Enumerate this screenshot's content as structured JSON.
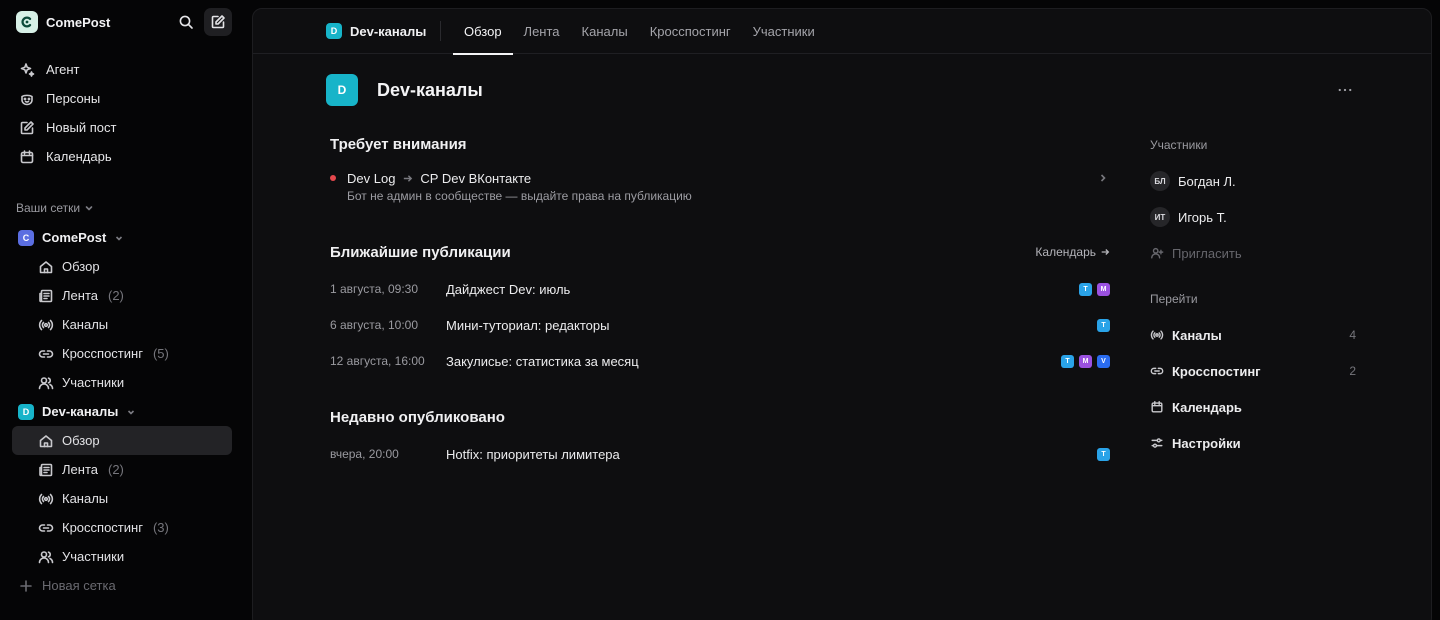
{
  "sidebar": {
    "brand": "ComePost",
    "nav": [
      {
        "label": "Агент",
        "icon": "sparkle-icon"
      },
      {
        "label": "Персоны",
        "icon": "persona-icon"
      },
      {
        "label": "Новый пост",
        "icon": "compose-icon"
      },
      {
        "label": "Календарь",
        "icon": "calendar-icon"
      }
    ],
    "networks_label": "Ваши сетки",
    "groups": [
      {
        "name": "ComePost",
        "initial": "C",
        "color": "#5b6ee1",
        "items": [
          {
            "label": "Обзор",
            "count": ""
          },
          {
            "label": "Лента",
            "count": "(2)"
          },
          {
            "label": "Каналы",
            "count": ""
          },
          {
            "label": "Кросспостинг",
            "count": "(5)"
          },
          {
            "label": "Участники",
            "count": ""
          }
        ]
      },
      {
        "name": "Dev-каналы",
        "initial": "D",
        "color": "#17b4c9",
        "items": [
          {
            "label": "Обзор",
            "count": ""
          },
          {
            "label": "Лента",
            "count": "(2)"
          },
          {
            "label": "Каналы",
            "count": ""
          },
          {
            "label": "Кросспостинг",
            "count": "(3)"
          },
          {
            "label": "Участники",
            "count": ""
          }
        ]
      }
    ],
    "new_network": "Новая сетка"
  },
  "topbar": {
    "crumb_initial": "D",
    "crumb_name": "Dev-каналы",
    "tabs": [
      "Обзор",
      "Лента",
      "Каналы",
      "Кросспостинг",
      "Участники"
    ],
    "active_tab": 0
  },
  "page": {
    "initial": "D",
    "title": "Dev-каналы"
  },
  "attention": {
    "title": "Требует внимания",
    "source": "Dev Log",
    "target": "CP Dev ВКонтакте",
    "description": "Бот не админ в сообществе — выдайте права на публикацию",
    "status_color": "#e5484d"
  },
  "upcoming": {
    "title": "Ближайшие публикации",
    "link": "Календарь",
    "rows": [
      {
        "date": "1 августа, 09:30",
        "title": "Дайджест Dev: июль",
        "badges": [
          "T",
          "M"
        ]
      },
      {
        "date": "6 августа, 10:00",
        "title": "Мини-туториал: редакторы",
        "badges": [
          "T"
        ]
      },
      {
        "date": "12 августа, 16:00",
        "title": "Закулисье: статистика за месяц",
        "badges": [
          "T",
          "M",
          "V"
        ]
      }
    ]
  },
  "recent": {
    "title": "Недавно опубликовано",
    "rows": [
      {
        "date": "вчера, 20:00",
        "title": "Hotfix: приоритеты лимитера",
        "badges": [
          "T"
        ]
      }
    ]
  },
  "badge_colors": {
    "T": "#2aa3e8",
    "M": "#9b51e0",
    "V": "#2a6cf0"
  },
  "members": {
    "label": "Участники",
    "list": [
      {
        "initials": "БЛ",
        "name": "Богдан Л."
      },
      {
        "initials": "ИТ",
        "name": "Игорь Т."
      }
    ],
    "invite": "Пригласить"
  },
  "jump": {
    "label": "Перейти",
    "items": [
      {
        "label": "Каналы",
        "count": "4",
        "icon": "channels-icon"
      },
      {
        "label": "Кросспостинг",
        "count": "2",
        "icon": "link-icon"
      },
      {
        "label": "Календарь",
        "count": "",
        "icon": "calendar-icon"
      },
      {
        "label": "Настройки",
        "count": "",
        "icon": "settings-icon"
      }
    ]
  }
}
